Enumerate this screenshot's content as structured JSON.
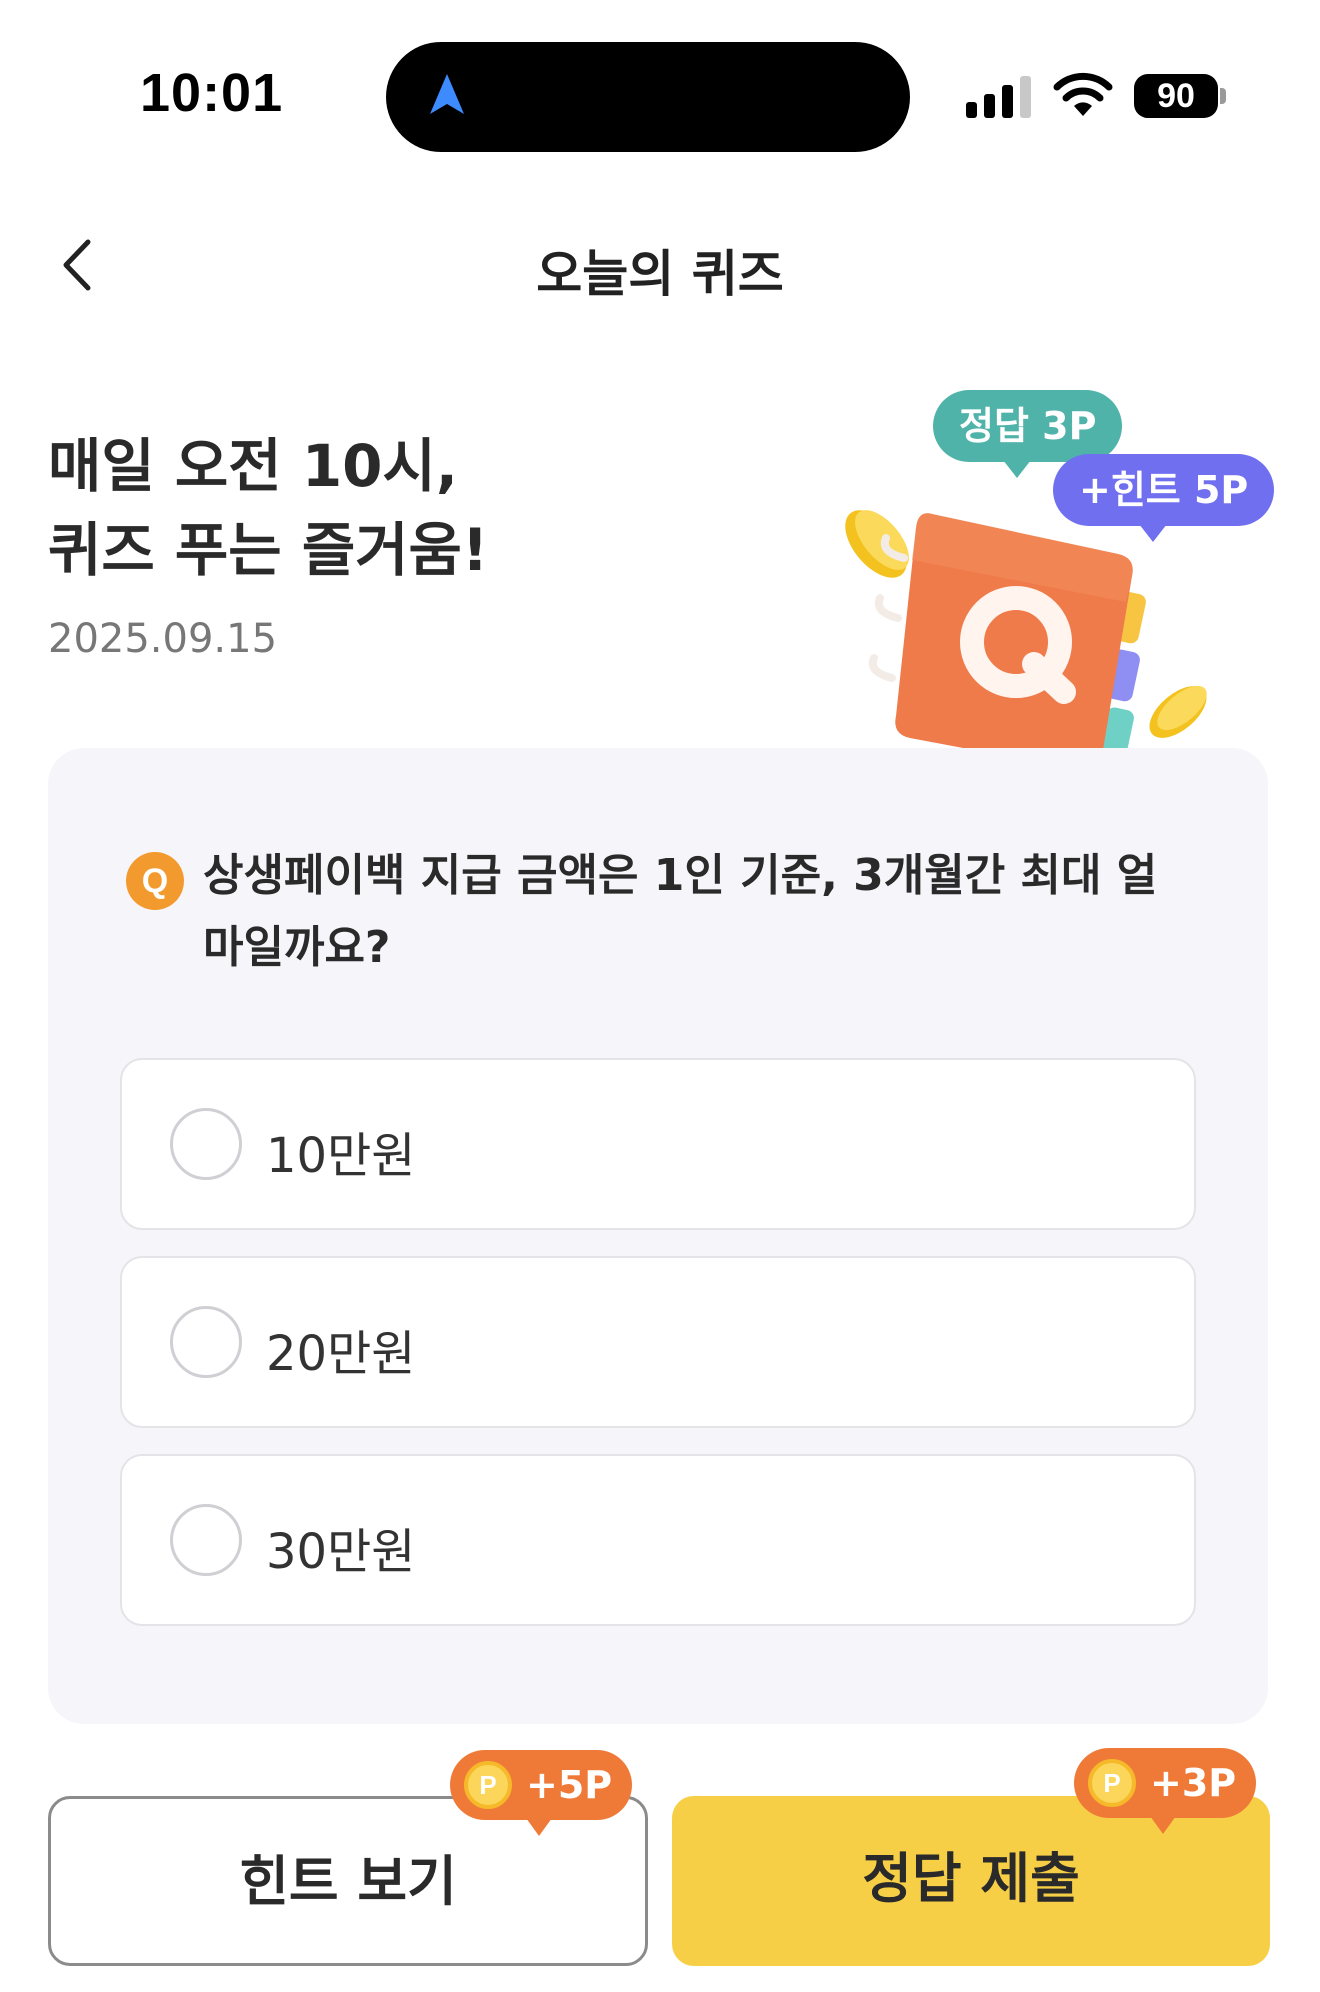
{
  "status_bar": {
    "time": "10:01",
    "battery": "90",
    "icons": [
      "location-arrow-icon",
      "cellular-signal-icon",
      "wifi-icon",
      "battery-icon"
    ]
  },
  "header": {
    "title": "오늘의 퀴즈",
    "back_icon": "chevron-left-icon"
  },
  "hero": {
    "title_line1": "매일 오전 10시,",
    "title_line2": "퀴즈 푸는 즐거움!",
    "date": "2025.09.15",
    "bubble_answer": "정답 3P",
    "bubble_hint": "+힌트 5P",
    "illustration_letter": "Q"
  },
  "quiz": {
    "badge": "Q",
    "question": "상생페이백 지급 금액은 1인 기준, 3개월간 최대 얼마일까요?",
    "options": [
      {
        "label": "10만원",
        "selected": false
      },
      {
        "label": "20만원",
        "selected": false
      },
      {
        "label": "30만원",
        "selected": false
      }
    ]
  },
  "actions": {
    "hint_label": "힌트 보기",
    "hint_points": "+5P",
    "submit_label": "정답 제출",
    "submit_points": "+3P",
    "coin_letter": "P"
  },
  "colors": {
    "accent_yellow": "#f7cf46",
    "badge_orange": "#ef7a37",
    "q_badge": "#f39a2e",
    "answer_bubble": "#4fb3a9",
    "hint_bubble": "#6f6ff0",
    "card_bg": "#f6f6fa"
  }
}
